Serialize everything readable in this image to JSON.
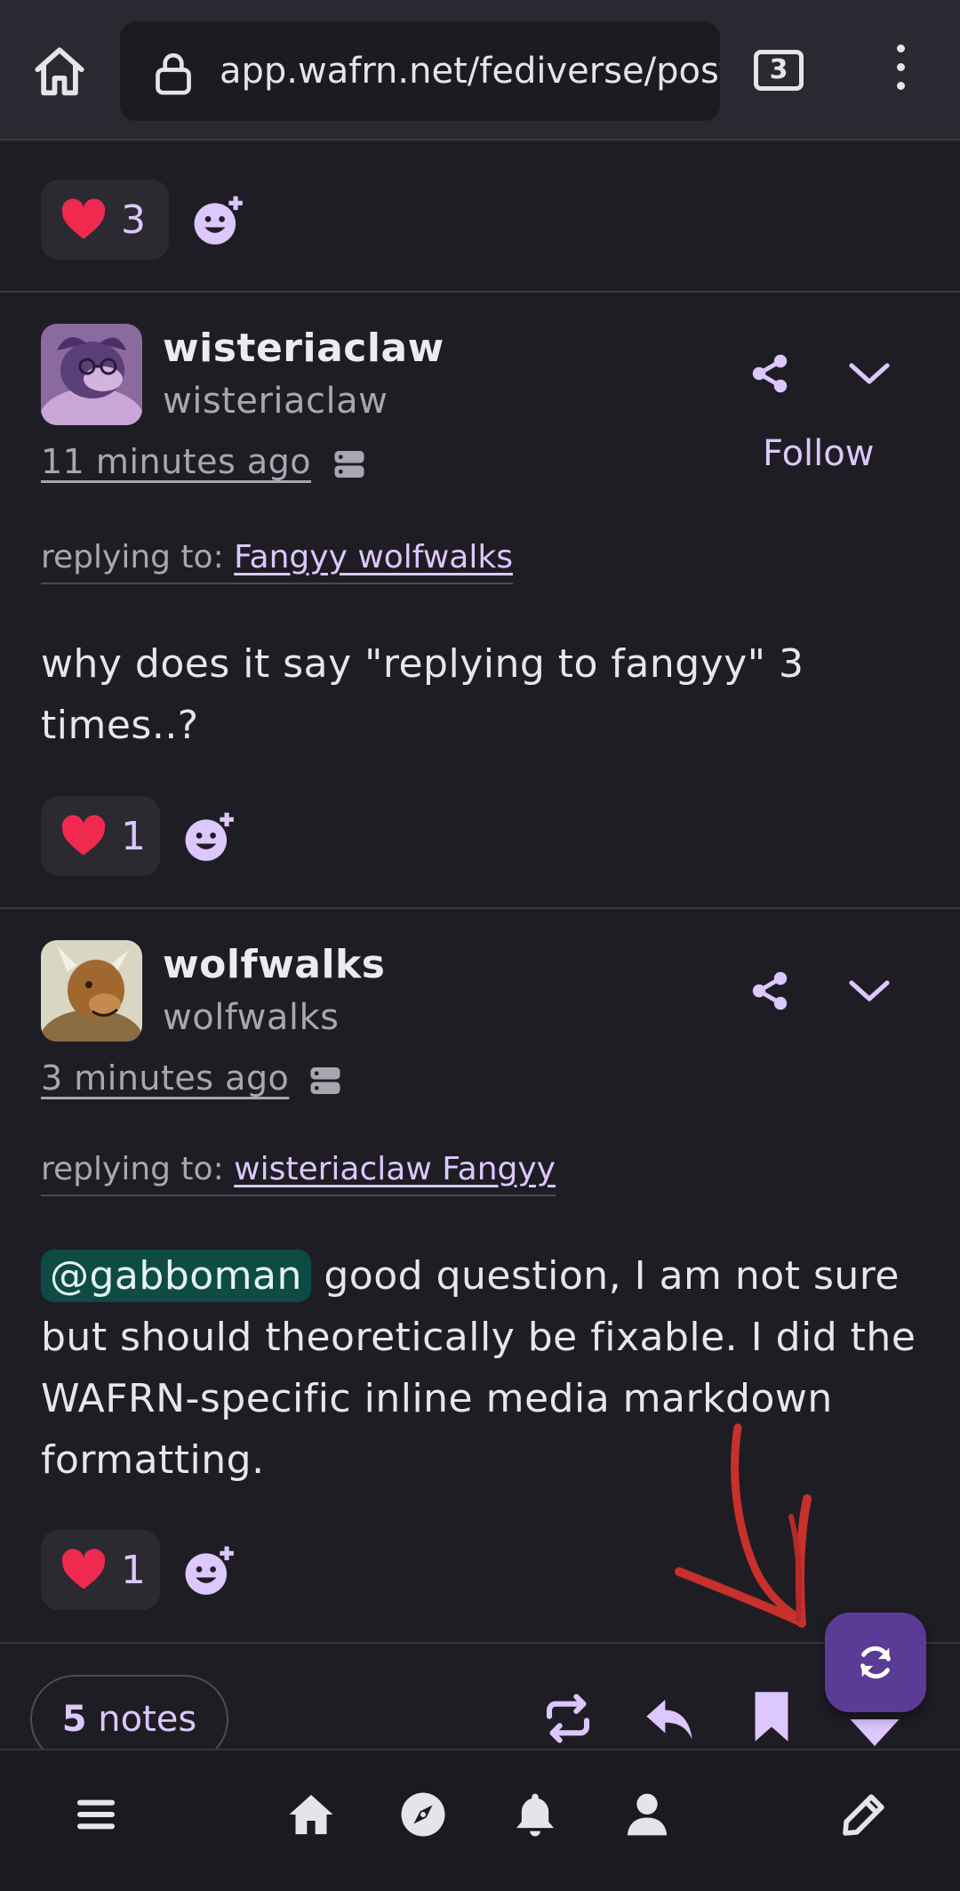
{
  "browser": {
    "url": "app.wafrn.net/fediverse/post/",
    "tab_count": "3"
  },
  "top_reactions": {
    "heart_count": "3"
  },
  "posts": [
    {
      "display_name": "wisteriaclaw",
      "handle": "wisteriaclaw",
      "timestamp": "11 minutes ago",
      "follow_label": "Follow",
      "replying_prefix": "replying to:",
      "replying_to": "Fangyy wolfwalks",
      "body": "why does it say \"replying to fangyy\" 3 times..?",
      "heart_count": "1"
    },
    {
      "display_name": "wolfwalks",
      "handle": "wolfwalks",
      "timestamp": "3 minutes ago",
      "replying_prefix": "replying to:",
      "replying_to": "wisteriaclaw Fangyy",
      "mention": "@gabboman",
      "body": " good question, I am not sure but should theoretically be fixable. I did the WAFRN-specific inline media markdown formatting.",
      "heart_count": "1"
    }
  ],
  "footer": {
    "notes_count": "5",
    "notes_label": "notes"
  },
  "colors": {
    "accent": "#dcc7ff",
    "fab": "#5a3c96",
    "mention_bg": "#0e4b45",
    "annotation": "#c8302c"
  },
  "icons": [
    "home-icon",
    "lock-icon",
    "tabs-icon",
    "menu-icon",
    "heart-icon",
    "emoji-add-icon",
    "server-icon",
    "share-icon",
    "chevron-down-icon",
    "reblog-icon",
    "reply-icon",
    "bookmark-icon",
    "refresh-icon",
    "hamburger-icon",
    "explore-icon",
    "bell-icon",
    "profile-icon",
    "pencil-icon"
  ]
}
